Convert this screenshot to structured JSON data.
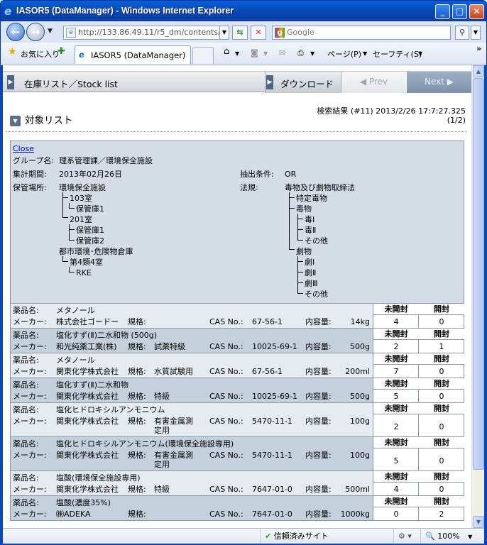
{
  "window": {
    "title": "IASOR5 (DataManager) - Windows Internet Explorer",
    "url": "http://133.86.49.11/r5_dm/contents/ir",
    "search_placeholder": "Google"
  },
  "favorites_bar": {
    "favorites_label": "お気に入り",
    "tab_label": "IASOR5 (DataManager)",
    "page_menu": "ページ(P)",
    "safety_menu": "セーフティ(S)"
  },
  "statusbar": {
    "trusted": "信頼済みサイト",
    "zoom": "100%"
  },
  "page": {
    "breadcrumb": "在庫リスト／Stock list",
    "download_label": "ダウンロード",
    "prev_label": "Prev",
    "next_label": "Next",
    "section_title": "対象リスト",
    "result_line1": "検索結果 (#11) 2013/2/26 17:7:27.325",
    "result_line2": "(1/2)"
  },
  "criteria": {
    "close_link": "Close",
    "group_label": "グループ名:",
    "group_value": "理系管理課／環境保全施設",
    "period_label": "集計期間:",
    "period_value": "2013年02月26日",
    "extract_label": "抽出条件:",
    "extract_value": "OR",
    "location_label": "保管場所:",
    "law_label": "法規:",
    "locations": {
      "facility": "環境保全施設",
      "room1": "103室",
      "store1": "保管庫1",
      "room2": "201室",
      "store2a": "保管庫1",
      "store2b": "保管庫2",
      "warehouse": "都市環境･危険物倉庫",
      "class4": "第4類4室",
      "rke": "RKE"
    },
    "laws": {
      "root": "毒物及び劇物取締法",
      "special": "特定毒物",
      "poison": "毒物",
      "p1": "毒Ⅰ",
      "p2": "毒Ⅱ",
      "p3": "その他",
      "deleterious": "劇物",
      "d1": "劇Ⅰ",
      "d2": "劇Ⅱ",
      "d3": "劇Ⅲ",
      "d4": "その他"
    }
  },
  "labels": {
    "drug": "薬品名:",
    "maker": "メーカー:",
    "spec": "規格:",
    "cas": "CAS No.:",
    "volume": "内容量:",
    "unopened": "未開封",
    "opened": "開封"
  },
  "items": [
    {
      "name": "メタノール",
      "maker": "株式会社ゴードー",
      "spec": "",
      "spec2": "",
      "cas": "67-56-1",
      "volume": "14kg",
      "unopened": "4",
      "opened": "0"
    },
    {
      "name": "塩化すず(Ⅱ)二水和物 (500g)",
      "maker": "和光純薬工業(株)",
      "spec": "試薬特級",
      "spec2": "",
      "cas": "10025-69-1",
      "volume": "500g",
      "unopened": "2",
      "opened": "1"
    },
    {
      "name": "メタノール",
      "maker": "関東化学株式会社",
      "spec": "水質試験用",
      "spec2": "",
      "cas": "67-56-1",
      "volume": "200ml",
      "unopened": "7",
      "opened": "0"
    },
    {
      "name": "塩化すず(Ⅱ)二水和物",
      "maker": "関東化学株式会社",
      "spec": "特級",
      "spec2": "",
      "cas": "10025-69-1",
      "volume": "500g",
      "unopened": "5",
      "opened": "0"
    },
    {
      "name": "塩化ヒドロキシルアンモニウム",
      "maker": "関東化学株式会社",
      "spec": "有害金属測",
      "spec2": "定用",
      "cas": "5470-11-1",
      "volume": "100g",
      "unopened": "2",
      "opened": "0"
    },
    {
      "name": "塩化ヒドロキシルアンモニウム(環境保全施設専用)",
      "maker": "関東化学株式会社",
      "spec": "有害金属測",
      "spec2": "定用",
      "cas": "5470-11-1",
      "volume": "100g",
      "unopened": "5",
      "opened": "0"
    },
    {
      "name": "塩酸(環境保全施設専用)",
      "maker": "関東化学株式会社",
      "spec": "特級",
      "spec2": "",
      "cas": "7647-01-0",
      "volume": "500ml",
      "unopened": "4",
      "opened": "0"
    },
    {
      "name": "塩酸(濃度35%)",
      "maker": "㈱ADEKA",
      "spec": "",
      "spec2": "",
      "cas": "7647-01-0",
      "volume": "1000kg",
      "unopened": "0",
      "opened": "2"
    }
  ]
}
